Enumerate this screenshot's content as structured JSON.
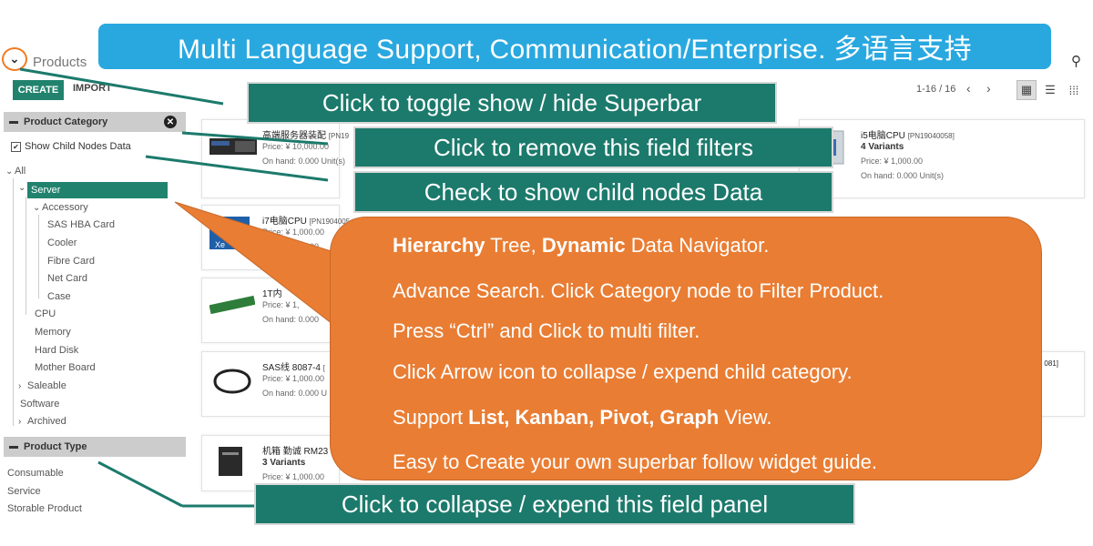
{
  "header": {
    "toggle_glyph": "⌄",
    "breadcrumb": "Products",
    "create_label": "CREATE",
    "import_label": "IMPORT",
    "pager": "1-16 / 16"
  },
  "sidebar": {
    "category_panel": {
      "title": "Product Category",
      "show_child_label": "Show Child Nodes Data",
      "tree": [
        {
          "label": "All"
        },
        {
          "label": "Server"
        },
        {
          "label": "Accessory"
        },
        {
          "label": "SAS HBA Card"
        },
        {
          "label": "Cooler"
        },
        {
          "label": "Fibre Card"
        },
        {
          "label": "Net Card"
        },
        {
          "label": "Case"
        },
        {
          "label": "CPU"
        },
        {
          "label": "Memory"
        },
        {
          "label": "Hard Disk"
        },
        {
          "label": "Mother Board"
        },
        {
          "label": "Saleable"
        },
        {
          "label": "Software"
        },
        {
          "label": "Archived"
        }
      ]
    },
    "type_panel": {
      "title": "Product Type",
      "items": [
        "Consumable",
        "Service",
        "Storable Product"
      ]
    }
  },
  "products": [
    {
      "name": "高端服务器装配",
      "ref": "[PN19",
      "price": "Price: ¥ 10,000.00",
      "onhand": "On hand: 0.000 Unit(s)"
    },
    {
      "name": "i5电脑CPU",
      "ref": "[PN19040058]",
      "variants": "4 Variants",
      "price": "Price: ¥ 1,000.00",
      "onhand": "On hand: 0.000 Unit(s)"
    },
    {
      "name": "i7电脑CPU",
      "ref": "[PN1904005",
      "price": "Price: ¥ 1,000.00",
      "onhand": "On hand: 0.000"
    },
    {
      "name": "1T内",
      "price": "Price: ¥ 1,",
      "onhand": "On hand: 0.000"
    },
    {
      "name": "SAS线 8087-4",
      "ref": "[",
      "price": "Price: ¥ 1,000.00",
      "onhand": "On hand: 0.000 U"
    },
    {
      "name": "机箱 勤诚 RM23",
      "variants": "3 Variants",
      "price": "Price: ¥ 1,000.00"
    },
    {
      "ref": "081]"
    }
  ],
  "overlay": {
    "banner": "Multi Language Support, Communication/Enterprise. 多语言支持",
    "tag_toggle": "Click to toggle show / hide Superbar",
    "tag_remove": "Click to remove this field filters",
    "tag_child": "Check to show child nodes Data",
    "tag_collapse": "Click to collapse / expend this field panel",
    "bubble": {
      "l1_b1": "Hierarchy",
      "l1_t1": " Tree, ",
      "l1_b2": "Dynamic",
      "l1_t2": " Data Navigator.",
      "l2": "Advance Search. Click Category node to Filter Product.",
      "l3": "Press “Ctrl” and Click to multi filter.",
      "l4": "Click Arrow icon to collapse / expend child category.",
      "l5_t1": "Support ",
      "l5_b": "List, Kanban, Pivot, Graph",
      "l5_t2": " View.",
      "l6": "Easy to Create your own superbar follow widget guide."
    }
  },
  "colors": {
    "accent": "#21836e",
    "banner": "#29a8e0",
    "bubble": "#e97d33",
    "tag": "#1c7a6c",
    "highlight_ring": "#f07c24"
  }
}
